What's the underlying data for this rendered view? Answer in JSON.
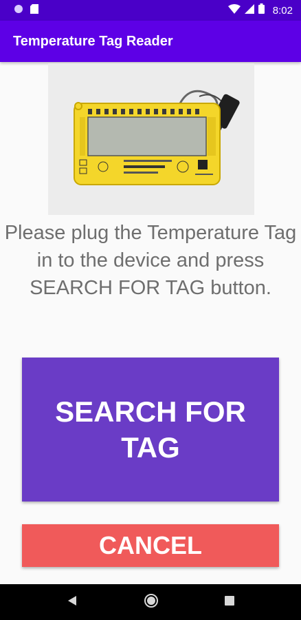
{
  "status_bar": {
    "time": "8:02",
    "icons": [
      "circle-notification-icon",
      "sd-card-icon",
      "wifi-icon",
      "signal-icon",
      "battery-icon"
    ]
  },
  "app_bar": {
    "title": "Temperature Tag Reader"
  },
  "device_image": {
    "icon": "temperature-tag-device-image",
    "colors": {
      "body": "#f4d62a",
      "screen": "#b4b9b0",
      "border": "#c9a800"
    }
  },
  "instructions": "Please plug the Temperature Tag in to the device and press SEARCH FOR TAG button.",
  "buttons": {
    "search_label": "SEARCH FOR TAG",
    "cancel_label": "CANCEL"
  },
  "nav_bar": {
    "icons": [
      "back-icon",
      "home-icon",
      "recents-icon"
    ]
  },
  "colors": {
    "status_bar": "#4a00c8",
    "app_bar": "#5d00e6",
    "search_button": "#6a3cc6",
    "cancel_button": "#f05a5a",
    "instruction_text": "#6e6e6e"
  }
}
